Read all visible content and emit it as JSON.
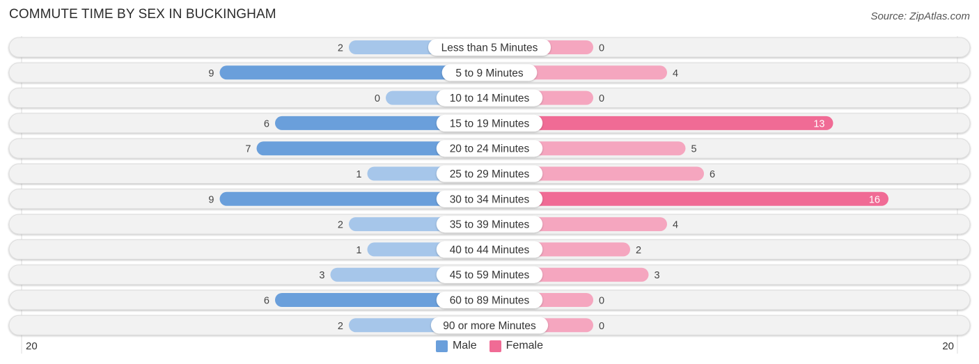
{
  "header": {
    "title": "COMMUTE TIME BY SEX IN BUCKINGHAM",
    "source": "Source: ZipAtlas.com"
  },
  "colors": {
    "male": "#6a9fdb",
    "male_light": "#a6c6ea",
    "female": "#f06b95",
    "female_light": "#f5a6bf",
    "row_bg": "#f2f2f2"
  },
  "chart_data": {
    "type": "bar",
    "orientation": "horizontal-diverging",
    "title": "COMMUTE TIME BY SEX IN BUCKINGHAM",
    "categories": [
      "Less than 5 Minutes",
      "5 to 9 Minutes",
      "10 to 14 Minutes",
      "15 to 19 Minutes",
      "20 to 24 Minutes",
      "25 to 29 Minutes",
      "30 to 34 Minutes",
      "35 to 39 Minutes",
      "40 to 44 Minutes",
      "45 to 59 Minutes",
      "60 to 89 Minutes",
      "90 or more Minutes"
    ],
    "series": [
      {
        "name": "Male",
        "values": [
          2,
          9,
          0,
          6,
          7,
          1,
          9,
          2,
          1,
          3,
          6,
          2
        ]
      },
      {
        "name": "Female",
        "values": [
          0,
          4,
          0,
          13,
          5,
          6,
          16,
          4,
          2,
          3,
          0,
          0
        ]
      }
    ],
    "axis": {
      "left_label": "20",
      "right_label": "20",
      "range": [
        -20,
        20
      ]
    },
    "legend": {
      "position": "bottom-center",
      "entries": [
        "Male",
        "Female"
      ]
    }
  }
}
